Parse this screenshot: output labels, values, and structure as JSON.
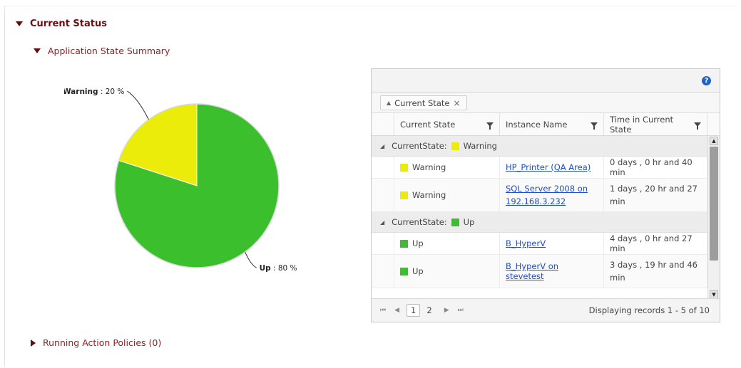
{
  "sections": {
    "current_status": "Current Status",
    "app_state_summary": "Application State Summary",
    "running_policies": "Running Action Policies (0)"
  },
  "colors": {
    "up": "#3cbf2d",
    "warning": "#ecec0a",
    "header": "#6a0f0f"
  },
  "chart_data": {
    "type": "pie",
    "slices": [
      {
        "name": "Warning",
        "value": 20,
        "label": "Warning",
        "pct": ": 20 %"
      },
      {
        "name": "Up",
        "value": 80,
        "label": "Up",
        "pct": ": 80 %"
      }
    ]
  },
  "grid": {
    "group_chip": "Current State",
    "columns": [
      "Current State",
      "Instance Name",
      "Time in Current State"
    ],
    "groups": [
      {
        "prefix": "CurrentState:",
        "state": "Warning",
        "rows": [
          {
            "state": "Warning",
            "instance": "HP_Printer (QA Area)",
            "instance2": "",
            "time": "0 days , 0 hr and 40 min",
            "time2": ""
          },
          {
            "state": "Warning",
            "instance": "SQL Server 2008 on",
            "instance2": "192.168.3.232",
            "time": "1 days , 20 hr and 27",
            "time2": "min"
          }
        ]
      },
      {
        "prefix": "CurrentState:",
        "state": "Up",
        "rows": [
          {
            "state": "Up",
            "instance": "B_HyperV",
            "instance2": "",
            "time": "4 days , 0 hr and 27 min",
            "time2": ""
          },
          {
            "state": "Up",
            "instance": "B_HyperV on stevetest",
            "instance2": "",
            "time": "3 days , 19 hr and 46",
            "time2": "min"
          }
        ]
      }
    ],
    "pager": {
      "first": "⏮",
      "prev": "◀",
      "pages": [
        "1",
        "2"
      ],
      "next": "▶",
      "last": "⏭",
      "info": "Displaying records 1 - 5 of 10"
    }
  }
}
